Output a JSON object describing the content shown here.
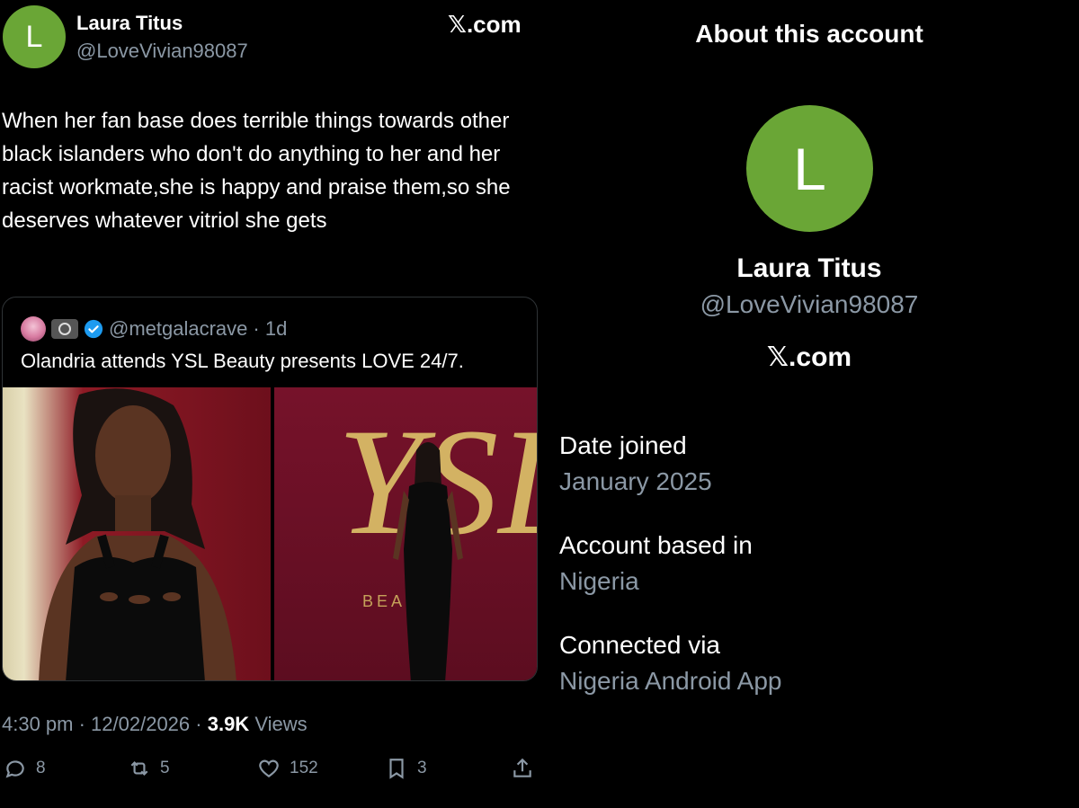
{
  "tweet": {
    "avatar_letter": "L",
    "author_name": "Laura Titus",
    "author_handle": "@LoveVivian98087",
    "site": "𝕏.com",
    "text": "When her fan base does terrible things towards other black islanders who don't do anything to her and her racist workmate,she is happy and praise them,so she deserves whatever vitriol she gets",
    "quote": {
      "handle": "@metgalacrave",
      "time": "· 1d",
      "text": "Olandria attends YSL Beauty presents LOVE 24/7.",
      "image_brand": "YSL",
      "image_caption": "BEA"
    },
    "meta": {
      "time_date": "4:30 pm · 12/02/2026 ·",
      "views_count": "3.9K",
      "views_label": "Views"
    },
    "actions": {
      "replies": "8",
      "reposts": "5",
      "likes": "152",
      "bookmarks": "3"
    }
  },
  "about": {
    "title": "About this account",
    "avatar_letter": "L",
    "name": "Laura Titus",
    "handle": "@LoveVivian98087",
    "site": "𝕏.com",
    "fields": [
      {
        "label": "Date joined",
        "value": "January 2025"
      },
      {
        "label": "Account based in",
        "value": "Nigeria"
      },
      {
        "label": "Connected via",
        "value": "Nigeria Android App"
      }
    ]
  },
  "colors": {
    "background": "#000000",
    "avatar": "#6aa636",
    "muted_text": "#8b98a5",
    "verified": "#1d9bf0"
  }
}
